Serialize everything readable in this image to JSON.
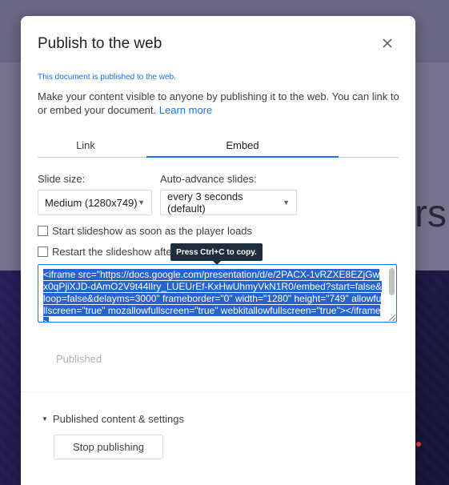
{
  "background": {
    "slide_text_fragment": "rs"
  },
  "dialog": {
    "title": "Publish to the web",
    "status": "This document is published to the web.",
    "description": "Make your content visible to anyone by publishing it to the web. You can link to or embed your document. ",
    "learn_more": "Learn more",
    "tabs": [
      {
        "label": "Link"
      },
      {
        "label": "Embed",
        "active": true
      }
    ],
    "slide_size": {
      "label": "Slide size:",
      "value": "Medium (1280x749)"
    },
    "auto_advance": {
      "label": "Auto-advance slides:",
      "value": "every 3 seconds (default)"
    },
    "checkboxes": [
      {
        "label": "Start slideshow as soon as the player loads",
        "checked": false
      },
      {
        "label": "Restart the slideshow after",
        "checked": false
      }
    ],
    "tooltip": "Press Ctrl+C to copy.",
    "embed_code": "<iframe src=\"https://docs.google.com/presentation/d/e/2PACX-1vRZXE8EZjGwx0qPjiXJD-dAmO2V9t44lIry_LUEUrEf-KxHwUhmyVkN1R0/embed?start=false&loop=false&delayms=3000\" frameborder=\"0\" width=\"1280\" height=\"749\" allowfullscreen=\"true\" mozallowfullscreen=\"true\" webkitallowfullscreen=\"true\"></iframe>",
    "published_label": "Published",
    "published_settings_label": "Published content & settings",
    "stop_button": "Stop publishing"
  },
  "colors": {
    "accent": "#1a73e8",
    "selection": "#2563cf",
    "tooltip_bg": "#1f2d3d"
  }
}
